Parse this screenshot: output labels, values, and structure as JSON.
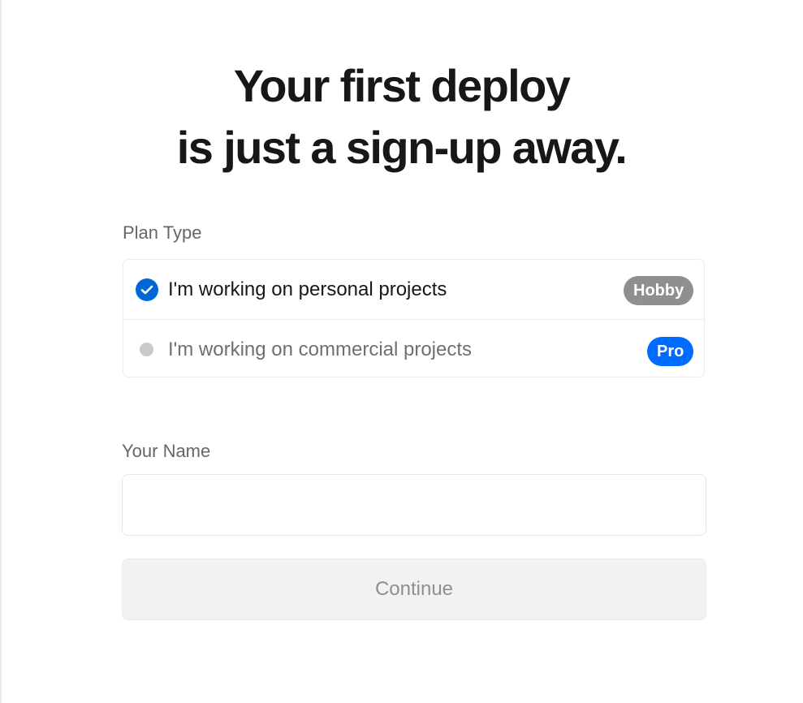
{
  "headline": {
    "line1": "Your first deploy",
    "line2": "is just a sign-up away."
  },
  "plan": {
    "label": "Plan Type",
    "options": [
      {
        "label": "I'm working on personal projects",
        "badge": "Hobby",
        "selected": true,
        "badge_color": "#8f8f8f"
      },
      {
        "label": "I'm working on commercial projects",
        "badge": "Pro",
        "selected": false,
        "badge_color": "#006bff"
      }
    ]
  },
  "name_field": {
    "label": "Your Name",
    "value": "",
    "placeholder": ""
  },
  "continue_button": {
    "label": "Continue",
    "disabled": true
  },
  "colors": {
    "accent": "#0068d6",
    "pro_badge": "#006bff",
    "hobby_badge": "#8f8f8f"
  },
  "icons": {
    "selected_radio": "check-circle-icon",
    "unselected_radio": "radio-dot-icon"
  }
}
